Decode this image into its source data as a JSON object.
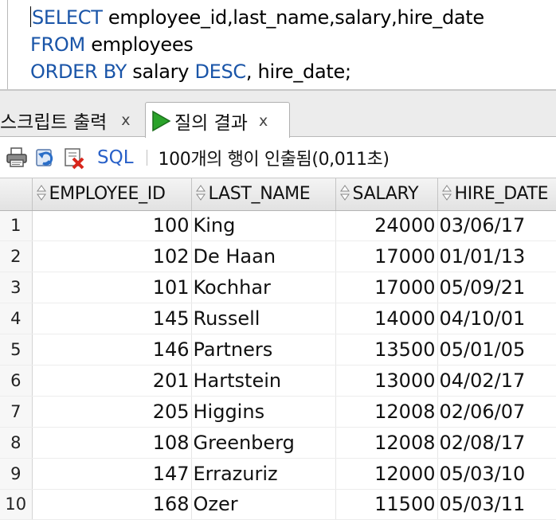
{
  "editor": {
    "line1": {
      "kw": "SELECT",
      "rest": " employee_id,last_name,salary,hire_date"
    },
    "line2": {
      "kw": "FROM",
      "rest": " employees"
    },
    "line3": {
      "kw1": "ORDER BY",
      "mid": " salary ",
      "kw2": "DESC",
      "rest": ", hire_date;"
    }
  },
  "tabs": {
    "script_output": {
      "label": "스크립트 출력",
      "close": "x"
    },
    "query_result": {
      "label": "질의 결과",
      "close": "x"
    }
  },
  "toolbar": {
    "sql_label": "SQL",
    "status": "100개의 행이 인출됨(0,011초)",
    "icons": [
      "print-icon",
      "refresh-icon",
      "clear-icon"
    ]
  },
  "grid": {
    "columns": [
      "EMPLOYEE_ID",
      "LAST_NAME",
      "SALARY",
      "HIRE_DATE"
    ],
    "rows": [
      {
        "n": "1",
        "id": "100",
        "name": "King",
        "salary": "24000",
        "date": "03/06/17"
      },
      {
        "n": "2",
        "id": "102",
        "name": "De Haan",
        "salary": "17000",
        "date": "01/01/13"
      },
      {
        "n": "3",
        "id": "101",
        "name": "Kochhar",
        "salary": "17000",
        "date": "05/09/21"
      },
      {
        "n": "4",
        "id": "145",
        "name": "Russell",
        "salary": "14000",
        "date": "04/10/01"
      },
      {
        "n": "5",
        "id": "146",
        "name": "Partners",
        "salary": "13500",
        "date": "05/01/05"
      },
      {
        "n": "6",
        "id": "201",
        "name": "Hartstein",
        "salary": "13000",
        "date": "04/02/17"
      },
      {
        "n": "7",
        "id": "205",
        "name": "Higgins",
        "salary": "12008",
        "date": "02/06/07"
      },
      {
        "n": "8",
        "id": "108",
        "name": "Greenberg",
        "salary": "12008",
        "date": "02/08/17"
      },
      {
        "n": "9",
        "id": "147",
        "name": "Errazuriz",
        "salary": "12000",
        "date": "05/03/10"
      },
      {
        "n": "10",
        "id": "168",
        "name": "Ozer",
        "salary": "11500",
        "date": "05/03/11"
      }
    ]
  },
  "colors": {
    "keyword": "#1a55a8",
    "link": "#2860c8",
    "run_green": "#2aa32a"
  }
}
